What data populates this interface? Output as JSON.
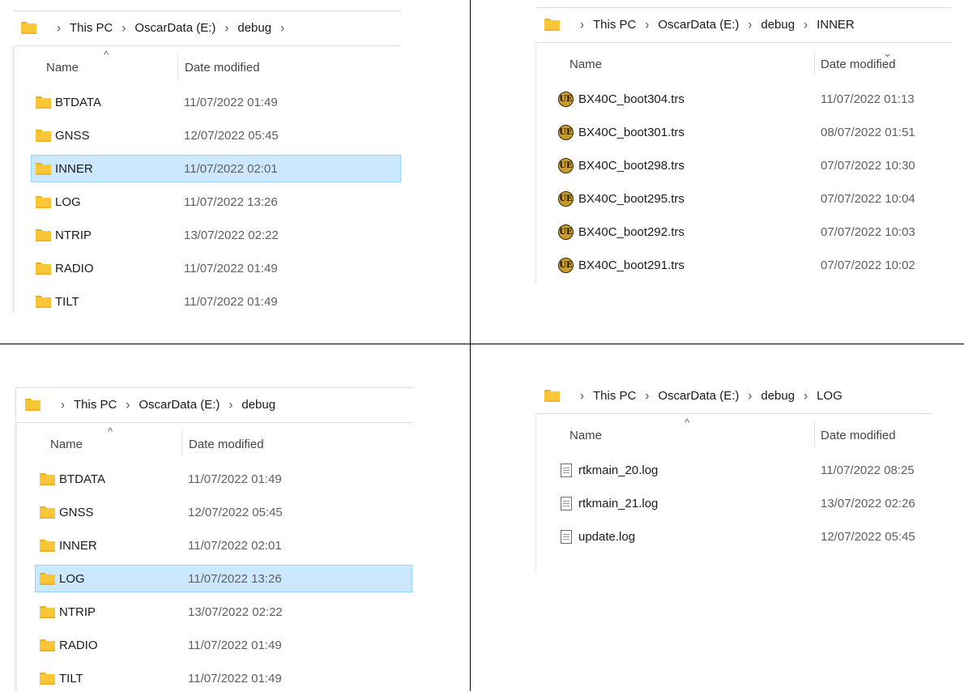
{
  "panes": {
    "top_left": {
      "breadcrumb": [
        "This PC",
        "OscarData (E:)",
        "debug"
      ],
      "columns": {
        "name": "Name",
        "date": "Date modified"
      },
      "rows": [
        {
          "name": "BTDATA",
          "date": "11/07/2022 01:49"
        },
        {
          "name": "GNSS",
          "date": "12/07/2022 05:45"
        },
        {
          "name": "INNER",
          "date": "11/07/2022 02:01",
          "selected": true
        },
        {
          "name": "LOG",
          "date": "11/07/2022 13:26"
        },
        {
          "name": "NTRIP",
          "date": "13/07/2022 02:22"
        },
        {
          "name": "RADIO",
          "date": "11/07/2022 01:49"
        },
        {
          "name": "TILT",
          "date": "11/07/2022 01:49"
        }
      ]
    },
    "top_right": {
      "breadcrumb": [
        "This PC",
        "OscarData (E:)",
        "debug",
        "INNER"
      ],
      "columns": {
        "name": "Name",
        "date": "Date modified"
      },
      "rows": [
        {
          "name": "BX40C_boot304.trs",
          "date": "11/07/2022 01:13",
          "icon": "ultraedit-icon"
        },
        {
          "name": "BX40C_boot301.trs",
          "date": "08/07/2022 01:51",
          "icon": "ultraedit-icon"
        },
        {
          "name": "BX40C_boot298.trs",
          "date": "07/07/2022 10:30",
          "icon": "ultraedit-icon"
        },
        {
          "name": "BX40C_boot295.trs",
          "date": "07/07/2022 10:04",
          "icon": "ultraedit-icon"
        },
        {
          "name": "BX40C_boot292.trs",
          "date": "07/07/2022 10:03",
          "icon": "ultraedit-icon"
        },
        {
          "name": "BX40C_boot291.trs",
          "date": "07/07/2022 10:02",
          "icon": "ultraedit-icon"
        }
      ]
    },
    "bottom_left": {
      "breadcrumb": [
        "This PC",
        "OscarData (E:)",
        "debug"
      ],
      "columns": {
        "name": "Name",
        "date": "Date modified"
      },
      "rows": [
        {
          "name": "BTDATA",
          "date": "11/07/2022 01:49"
        },
        {
          "name": "GNSS",
          "date": "12/07/2022 05:45"
        },
        {
          "name": "INNER",
          "date": "11/07/2022 02:01"
        },
        {
          "name": "LOG",
          "date": "11/07/2022 13:26",
          "selected": true
        },
        {
          "name": "NTRIP",
          "date": "13/07/2022 02:22"
        },
        {
          "name": "RADIO",
          "date": "11/07/2022 01:49"
        },
        {
          "name": "TILT",
          "date": "11/07/2022 01:49"
        }
      ]
    },
    "bottom_right": {
      "breadcrumb": [
        "This PC",
        "OscarData (E:)",
        "debug",
        "LOG"
      ],
      "columns": {
        "name": "Name",
        "date": "Date modified"
      },
      "rows": [
        {
          "name": "rtkmain_20.log",
          "date": "11/07/2022 08:25",
          "icon": "log-file-icon"
        },
        {
          "name": "rtkmain_21.log",
          "date": "13/07/2022 02:26",
          "icon": "log-file-icon"
        },
        {
          "name": "update.log",
          "date": "12/07/2022 05:45",
          "icon": "log-file-icon"
        }
      ]
    }
  },
  "icons": {
    "folder_color": "#f8c636",
    "selection_color": "#cce8ff",
    "ue_glyph": "UE"
  }
}
